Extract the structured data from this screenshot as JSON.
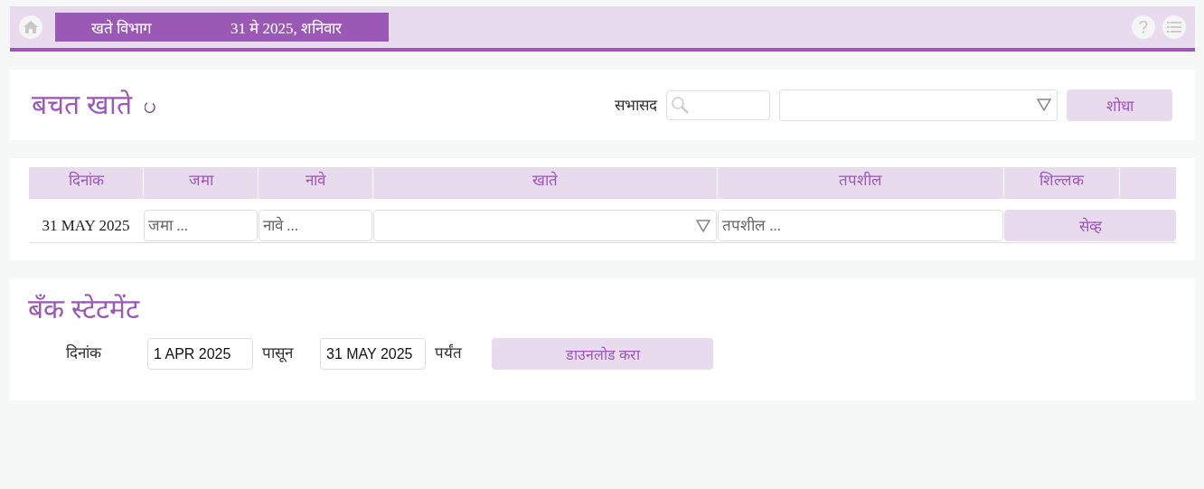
{
  "header": {
    "section": "खते विभाग",
    "date": "31 मे 2025,  शनिवार"
  },
  "accounts": {
    "title": "बचत खाते",
    "member_label": "सभासद",
    "search_button": "शोधा"
  },
  "entry_table": {
    "columns": [
      "दिनांक",
      "जमा",
      "नावे",
      "खाते",
      "तपशील",
      "शिल्लक"
    ],
    "row": {
      "date": "31 MAY 2025",
      "credit_placeholder": "जमा ...",
      "debit_placeholder": "नावे ...",
      "details_placeholder": "तपशील ...",
      "save_button": "सेव्ह"
    }
  },
  "statement": {
    "title": "बँक स्टेटमेंट",
    "date_label": "दिनांक",
    "from_value": "1 APR 2025",
    "from_label": "पासून",
    "to_value": "31 MAY 2025",
    "to_label": "पर्यंत",
    "download_button": "डाउनलोड करा"
  }
}
